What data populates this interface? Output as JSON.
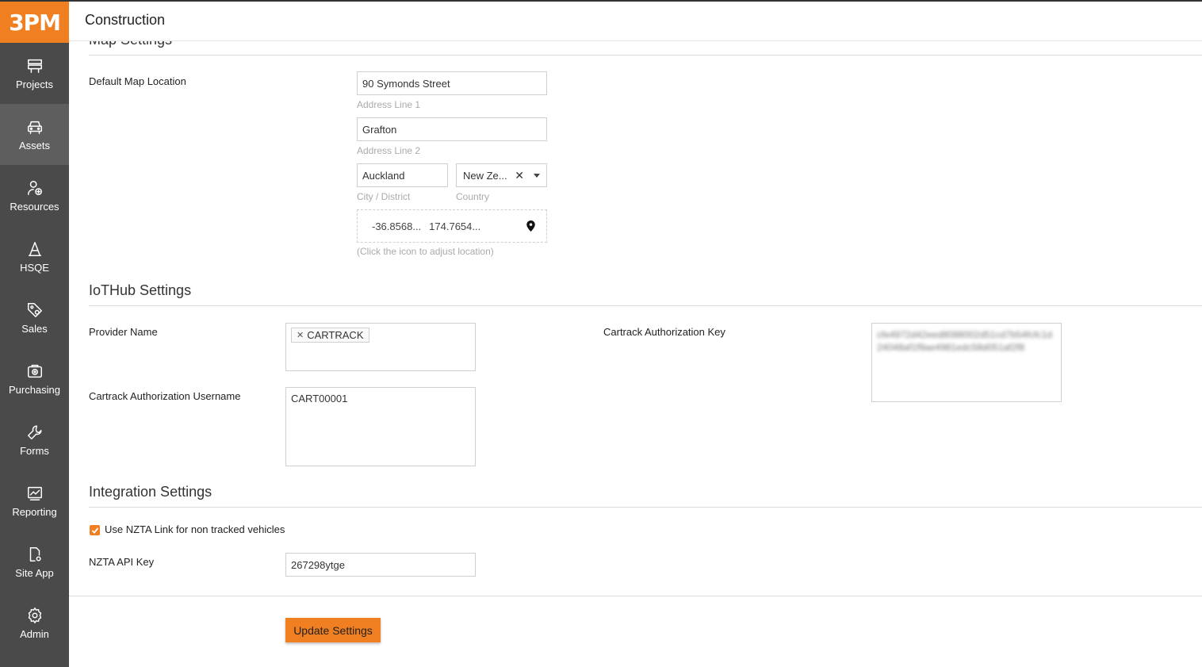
{
  "app": {
    "logo": "3PM",
    "header_title": "Construction"
  },
  "sidebar": {
    "items": [
      {
        "label": "Projects",
        "icon": "projects-icon"
      },
      {
        "label": "Assets",
        "icon": "car-icon",
        "active": true
      },
      {
        "label": "Resources",
        "icon": "resources-icon"
      },
      {
        "label": "HSQE",
        "icon": "hsqe-icon"
      },
      {
        "label": "Sales",
        "icon": "tag-icon"
      },
      {
        "label": "Purchasing",
        "icon": "purchasing-icon"
      },
      {
        "label": "Forms",
        "icon": "wrench-icon"
      },
      {
        "label": "Reporting",
        "icon": "reporting-icon"
      },
      {
        "label": "Site App",
        "icon": "site-app-icon"
      },
      {
        "label": "Admin",
        "icon": "gear-icon"
      }
    ]
  },
  "map_settings": {
    "heading": "Map Settings",
    "default_location_label": "Default Map Location",
    "address_line1": {
      "value": "90 Symonds Street",
      "help": "Address Line 1"
    },
    "address_line2": {
      "value": "Grafton",
      "help": "Address Line 2"
    },
    "city": {
      "value": "Auckland",
      "help": "City / District"
    },
    "country": {
      "value": "New Ze...",
      "help": "Country"
    },
    "latitude": "-36.8568...",
    "longitude": "174.7654...",
    "location_help": "(Click the icon to adjust location)"
  },
  "iothub_settings": {
    "heading": "IoTHub Settings",
    "provider_label": "Provider Name",
    "provider_tag": "CARTRACK",
    "username_label": "Cartrack Authorization Username",
    "username_value": "CART00001",
    "key_label": "Cartrack Authorization Key",
    "key_value": "cfe4972d42eed8088002d51cd7b54fcfc1d24048af1f9ae4981edc58d051af2f8"
  },
  "integration_settings": {
    "heading": "Integration Settings",
    "nzta_checkbox_label": "Use NZTA Link for non tracked vehicles",
    "nzta_checked": true,
    "api_key_label": "NZTA API Key",
    "api_key_value": "267298ytge"
  },
  "actions": {
    "update_label": "Update Settings"
  },
  "colors": {
    "accent": "#f07f21",
    "sidebar_bg": "#4a4a4a",
    "sidebar_active": "#5e5e5e"
  }
}
